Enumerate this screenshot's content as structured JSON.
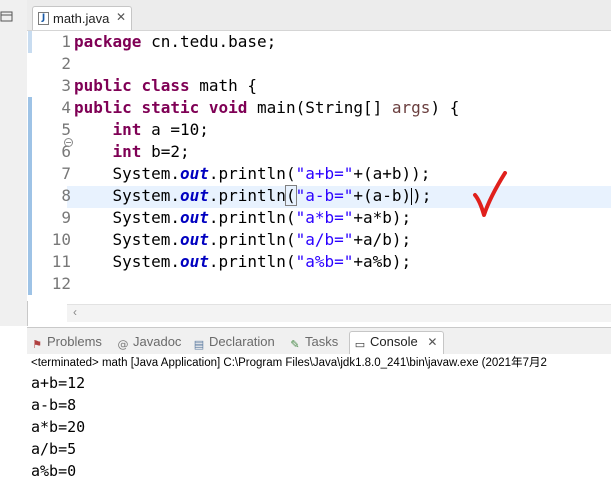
{
  "editor": {
    "tab_title": "math.java",
    "code_lines": [
      {
        "n": "1",
        "segs": [
          {
            "t": "package",
            "c": "kw"
          },
          {
            "t": " cn.tedu.base;",
            "c": ""
          }
        ]
      },
      {
        "n": "2",
        "segs": []
      },
      {
        "n": "3",
        "segs": [
          {
            "t": "public",
            "c": "kw"
          },
          {
            "t": " ",
            "c": ""
          },
          {
            "t": "class",
            "c": "kw"
          },
          {
            "t": " math {",
            "c": ""
          }
        ]
      },
      {
        "n": "4",
        "segs": [
          {
            "t": "public",
            "c": "kw"
          },
          {
            "t": " ",
            "c": ""
          },
          {
            "t": "static",
            "c": "kw"
          },
          {
            "t": " ",
            "c": ""
          },
          {
            "t": "void",
            "c": "kw"
          },
          {
            "t": " main(String[] ",
            "c": ""
          },
          {
            "t": "args",
            "c": "arg"
          },
          {
            "t": ") {",
            "c": ""
          }
        ]
      },
      {
        "n": "5",
        "segs": [
          {
            "t": "    ",
            "c": ""
          },
          {
            "t": "int",
            "c": "kw"
          },
          {
            "t": " a =10;",
            "c": ""
          }
        ]
      },
      {
        "n": "6",
        "segs": [
          {
            "t": "    ",
            "c": ""
          },
          {
            "t": "int",
            "c": "kw"
          },
          {
            "t": " b=2;",
            "c": ""
          }
        ]
      },
      {
        "n": "7",
        "segs": [
          {
            "t": "    System.",
            "c": ""
          },
          {
            "t": "out",
            "c": "fld"
          },
          {
            "t": ".println(",
            "c": ""
          },
          {
            "t": "\"a+b=\"",
            "c": "str"
          },
          {
            "t": "+(a+b));",
            "c": ""
          }
        ]
      },
      {
        "n": "8",
        "segs": [
          {
            "t": "    System.",
            "c": ""
          },
          {
            "t": "out",
            "c": "fld"
          },
          {
            "t": ".println",
            "c": ""
          },
          {
            "t": "(",
            "c": "bracket"
          },
          {
            "t": "\"a-b=\"",
            "c": "str"
          },
          {
            "t": "+(a-b)",
            "c": ""
          },
          {
            "t": "",
            "c": "caret"
          },
          {
            "t": ");",
            "c": ""
          }
        ]
      },
      {
        "n": "9",
        "segs": [
          {
            "t": "    System.",
            "c": ""
          },
          {
            "t": "out",
            "c": "fld"
          },
          {
            "t": ".println(",
            "c": ""
          },
          {
            "t": "\"a*b=\"",
            "c": "str"
          },
          {
            "t": "+a*b);",
            "c": ""
          }
        ]
      },
      {
        "n": "10",
        "segs": [
          {
            "t": "    System.",
            "c": ""
          },
          {
            "t": "out",
            "c": "fld"
          },
          {
            "t": ".println(",
            "c": ""
          },
          {
            "t": "\"a/b=\"",
            "c": "str"
          },
          {
            "t": "+a/b);",
            "c": ""
          }
        ]
      },
      {
        "n": "11",
        "segs": [
          {
            "t": "    System.",
            "c": ""
          },
          {
            "t": "out",
            "c": "fld"
          },
          {
            "t": ".println(",
            "c": ""
          },
          {
            "t": "\"a%b=\"",
            "c": "str"
          },
          {
            "t": "+a%b);",
            "c": ""
          }
        ]
      },
      {
        "n": "12",
        "segs": []
      }
    ]
  },
  "views": {
    "problems": "Problems",
    "javadoc": "Javadoc",
    "declaration": "Declaration",
    "tasks": "Tasks",
    "console": "Console"
  },
  "console": {
    "header": "<terminated> math [Java Application] C:\\Program Files\\Java\\jdk1.8.0_241\\bin\\javaw.exe (2021年7月2",
    "output": [
      "a+b=12",
      "a-b=8",
      "a*b=20",
      "a/b=5",
      "a%b=0"
    ]
  },
  "colors": {
    "keyword": "#7f0055",
    "string": "#2a00ff",
    "field": "#0000c0",
    "annotation_mark": "#e0201c"
  },
  "icons": {
    "file": "java-file-icon",
    "close": "close-icon",
    "fold": "fold-collapse-icon",
    "problems": "problems-icon",
    "javadoc": "javadoc-icon",
    "declaration": "declaration-icon",
    "tasks": "tasks-icon",
    "console": "console-icon"
  }
}
